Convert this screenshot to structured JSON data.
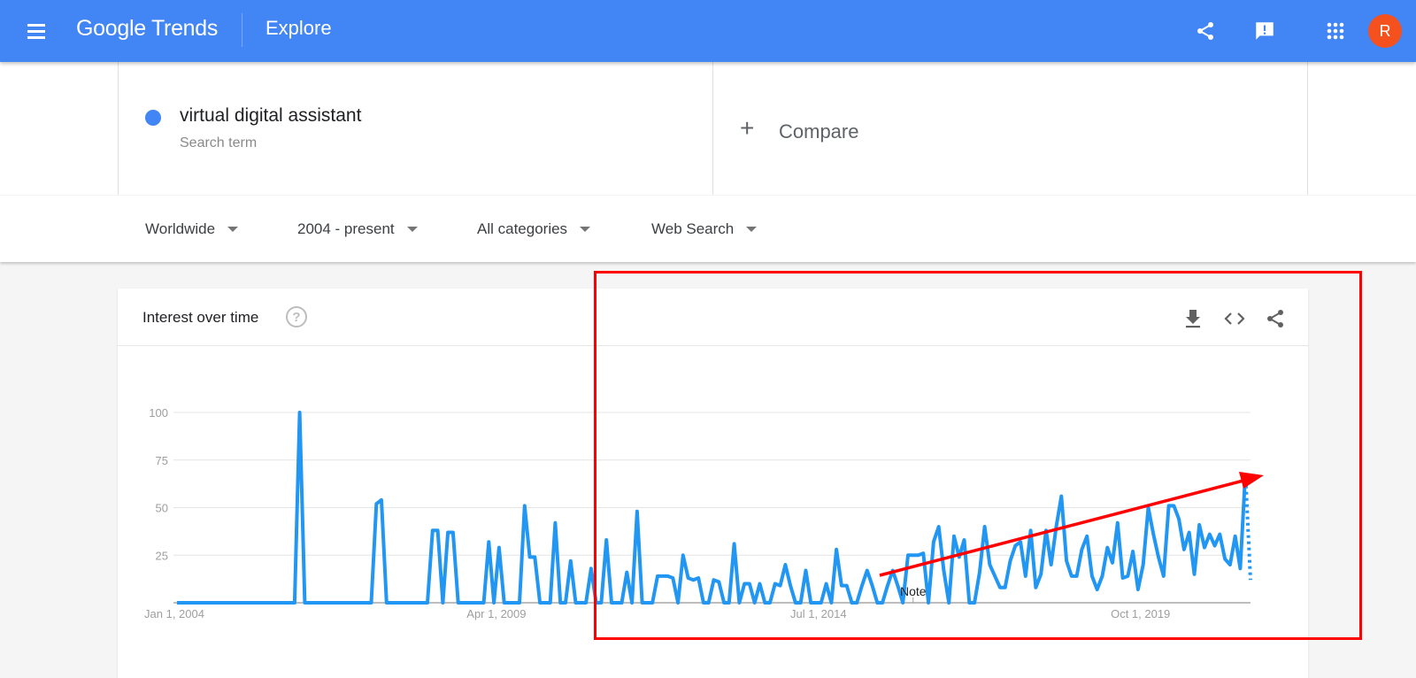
{
  "topbar": {
    "menu_icon": "hamburger-menu-icon",
    "logo_text": "Google Trends",
    "section_title": "Explore",
    "actions": [
      {
        "name": "share",
        "icon": "share-icon"
      },
      {
        "name": "feedback",
        "icon": "feedback-icon"
      },
      {
        "name": "apps",
        "icon": "apps-grid-icon"
      }
    ],
    "avatar_initial": "R",
    "avatar_color": "#f4511e",
    "brand_color": "#4285f4"
  },
  "search_term": {
    "name": "virtual digital assistant",
    "subtitle": "Search term",
    "color": "#4285f4"
  },
  "compare": {
    "plus": "+",
    "label": "Compare"
  },
  "filters": [
    {
      "label": "Worldwide"
    },
    {
      "label": "2004 - present"
    },
    {
      "label": "All categories"
    },
    {
      "label": "Web Search"
    }
  ],
  "card": {
    "title": "Interest over time",
    "help": "?",
    "actions": [
      "download-icon",
      "embed-code-icon",
      "share-icon"
    ]
  },
  "annotation": {
    "box_color": "#ff0000",
    "arrow_color": "#ff0000",
    "arrow_meaning": "upward trend"
  },
  "chart_data": {
    "type": "line",
    "title": "Interest over time",
    "xlabel": "",
    "ylabel": "",
    "ylim": [
      0,
      100
    ],
    "yticks": [
      25,
      50,
      75,
      100
    ],
    "xticks": [
      "Jan 1, 2004",
      "Apr 1, 2009",
      "Jul 1, 2014",
      "Oct 1, 2019"
    ],
    "grid": true,
    "note_label": "Note",
    "note_date": "Jan 2016",
    "start": "2004-01",
    "frequency": "monthly",
    "series": [
      {
        "name": "virtual digital assistant",
        "color": "#2196f3",
        "partial_last_point": true,
        "values": [
          0,
          0,
          0,
          0,
          0,
          0,
          0,
          0,
          0,
          0,
          0,
          0,
          0,
          0,
          0,
          0,
          0,
          0,
          0,
          0,
          0,
          0,
          0,
          0,
          100,
          0,
          0,
          0,
          0,
          0,
          0,
          0,
          0,
          0,
          0,
          0,
          0,
          0,
          0,
          52,
          54,
          0,
          0,
          0,
          0,
          0,
          0,
          0,
          0,
          0,
          38,
          38,
          0,
          37,
          37,
          0,
          0,
          0,
          0,
          0,
          0,
          32,
          0,
          29,
          0,
          0,
          0,
          0,
          51,
          24,
          24,
          0,
          0,
          0,
          42,
          0,
          0,
          22,
          0,
          0,
          0,
          18,
          0,
          0,
          33,
          0,
          0,
          0,
          16,
          0,
          48,
          0,
          0,
          0,
          14,
          14,
          14,
          13,
          0,
          25,
          13,
          12,
          13,
          0,
          0,
          12,
          11,
          0,
          0,
          31,
          0,
          10,
          10,
          0,
          10,
          0,
          0,
          10,
          9,
          20,
          9,
          0,
          0,
          17,
          0,
          0,
          0,
          10,
          0,
          28,
          9,
          9,
          0,
          0,
          9,
          17,
          9,
          0,
          0,
          9,
          17,
          9,
          0,
          25,
          25,
          25,
          26,
          0,
          32,
          40,
          17,
          0,
          35,
          24,
          33,
          0,
          0,
          16,
          40,
          20,
          14,
          8,
          8,
          22,
          30,
          32,
          14,
          38,
          8,
          15,
          38,
          20,
          40,
          56,
          22,
          14,
          14,
          28,
          35,
          14,
          7,
          14,
          29,
          21,
          42,
          13,
          14,
          27,
          7,
          20,
          50,
          36,
          24,
          14,
          51,
          51,
          44,
          28,
          37,
          15,
          41,
          29,
          36,
          30,
          36,
          23,
          20,
          35,
          18,
          68,
          12
        ]
      }
    ]
  }
}
